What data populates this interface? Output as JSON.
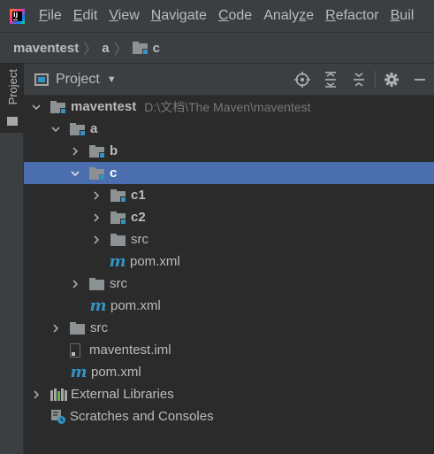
{
  "menu": {
    "items": [
      {
        "pre": "",
        "mnemonic": "F",
        "post": "ile"
      },
      {
        "pre": "",
        "mnemonic": "E",
        "post": "dit"
      },
      {
        "pre": "",
        "mnemonic": "V",
        "post": "iew"
      },
      {
        "pre": "",
        "mnemonic": "N",
        "post": "avigate"
      },
      {
        "pre": "",
        "mnemonic": "C",
        "post": "ode"
      },
      {
        "pre": "Analy",
        "mnemonic": "z",
        "post": "e"
      },
      {
        "pre": "",
        "mnemonic": "R",
        "post": "efactor"
      },
      {
        "pre": "",
        "mnemonic": "B",
        "post": "uil"
      }
    ]
  },
  "breadcrumb": [
    "maventest",
    "a",
    "c"
  ],
  "tool_window": {
    "stripe_label": "Project",
    "title": "Project",
    "actions": [
      "locate-icon",
      "expand-all-icon",
      "collapse-all-icon",
      "gear-icon",
      "minimize-icon"
    ]
  },
  "tree": {
    "root": {
      "label": "maventest",
      "path": "D:\\文档\\The Maven\\maventest"
    },
    "a": "a",
    "b": "b",
    "c": "c",
    "c1": "c1",
    "c2": "c2",
    "c_src": "src",
    "c_pom": "pom.xml",
    "a_src": "src",
    "a_pom": "pom.xml",
    "root_src": "src",
    "root_iml": "maventest.iml",
    "root_pom": "pom.xml",
    "external_libraries": "External Libraries",
    "scratches": "Scratches and Consoles"
  },
  "colors": {
    "selection": "#4b6eaf",
    "module_mark": "#3592c4",
    "background": "#2b2b2b"
  }
}
